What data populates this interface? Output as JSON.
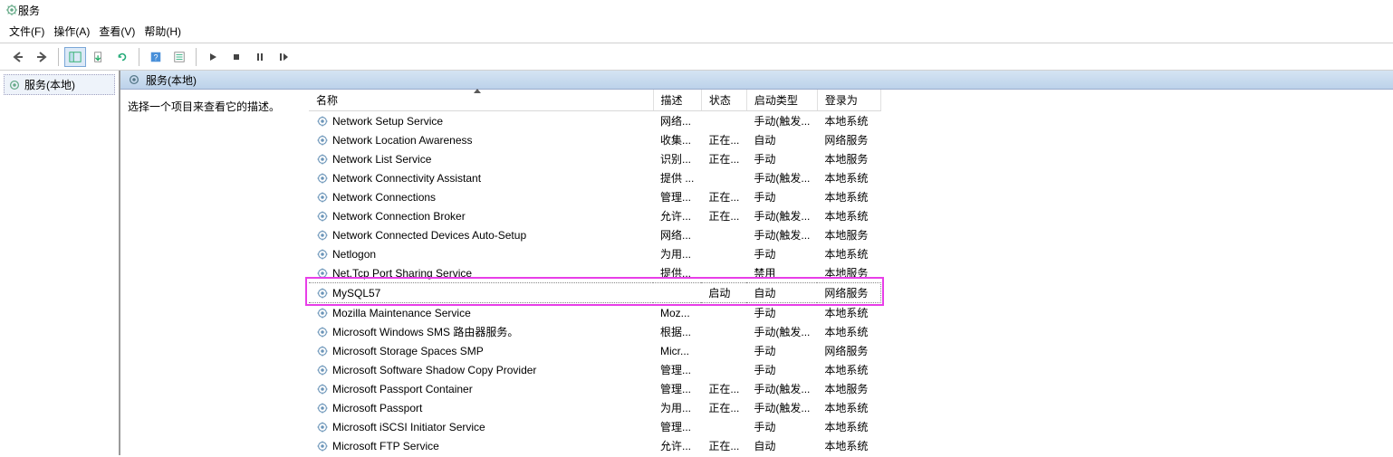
{
  "window": {
    "title": "服务"
  },
  "menu": {
    "file": "文件(F)",
    "action": "操作(A)",
    "view": "查看(V)",
    "help": "帮助(H)"
  },
  "left": {
    "node": "服务(本地)"
  },
  "header": {
    "label": "服务(本地)"
  },
  "detail": {
    "hint": "选择一个项目来查看它的描述。"
  },
  "columns": {
    "name": "名称",
    "desc": "描述",
    "state": "状态",
    "startup": "启动类型",
    "logon": "登录为"
  },
  "services": [
    {
      "name": "Network Setup Service",
      "desc": "网络...",
      "state": "",
      "startup": "手动(触发...",
      "logon": "本地系统",
      "sel": false
    },
    {
      "name": "Network Location Awareness",
      "desc": "收集...",
      "state": "正在...",
      "startup": "自动",
      "logon": "网络服务",
      "sel": false
    },
    {
      "name": "Network List Service",
      "desc": "识别...",
      "state": "正在...",
      "startup": "手动",
      "logon": "本地服务",
      "sel": false
    },
    {
      "name": "Network Connectivity Assistant",
      "desc": "提供 ...",
      "state": "",
      "startup": "手动(触发...",
      "logon": "本地系统",
      "sel": false
    },
    {
      "name": "Network Connections",
      "desc": "管理...",
      "state": "正在...",
      "startup": "手动",
      "logon": "本地系统",
      "sel": false
    },
    {
      "name": "Network Connection Broker",
      "desc": "允许...",
      "state": "正在...",
      "startup": "手动(触发...",
      "logon": "本地系统",
      "sel": false
    },
    {
      "name": "Network Connected Devices Auto-Setup",
      "desc": "网络...",
      "state": "",
      "startup": "手动(触发...",
      "logon": "本地服务",
      "sel": false
    },
    {
      "name": "Netlogon",
      "desc": "为用...",
      "state": "",
      "startup": "手动",
      "logon": "本地系统",
      "sel": false
    },
    {
      "name": "Net.Tcp Port Sharing Service",
      "desc": "提供...",
      "state": "",
      "startup": "禁用",
      "logon": "本地服务",
      "sel": false
    },
    {
      "name": "MySQL57",
      "desc": "",
      "state": "启动",
      "startup": "自动",
      "logon": "网络服务",
      "sel": true
    },
    {
      "name": "Mozilla Maintenance Service",
      "desc": "Moz...",
      "state": "",
      "startup": "手动",
      "logon": "本地系统",
      "sel": false
    },
    {
      "name": "Microsoft Windows SMS 路由器服务。",
      "desc": "根据...",
      "state": "",
      "startup": "手动(触发...",
      "logon": "本地系统",
      "sel": false
    },
    {
      "name": "Microsoft Storage Spaces SMP",
      "desc": "Micr...",
      "state": "",
      "startup": "手动",
      "logon": "网络服务",
      "sel": false
    },
    {
      "name": "Microsoft Software Shadow Copy Provider",
      "desc": "管理...",
      "state": "",
      "startup": "手动",
      "logon": "本地系统",
      "sel": false
    },
    {
      "name": "Microsoft Passport Container",
      "desc": "管理...",
      "state": "正在...",
      "startup": "手动(触发...",
      "logon": "本地服务",
      "sel": false
    },
    {
      "name": "Microsoft Passport",
      "desc": "为用...",
      "state": "正在...",
      "startup": "手动(触发...",
      "logon": "本地系统",
      "sel": false
    },
    {
      "name": "Microsoft iSCSI Initiator Service",
      "desc": "管理...",
      "state": "",
      "startup": "手动",
      "logon": "本地系统",
      "sel": false
    },
    {
      "name": "Microsoft FTP Service",
      "desc": "允许...",
      "state": "正在...",
      "startup": "自动",
      "logon": "本地系统",
      "sel": false
    }
  ],
  "highlight_index": 9
}
